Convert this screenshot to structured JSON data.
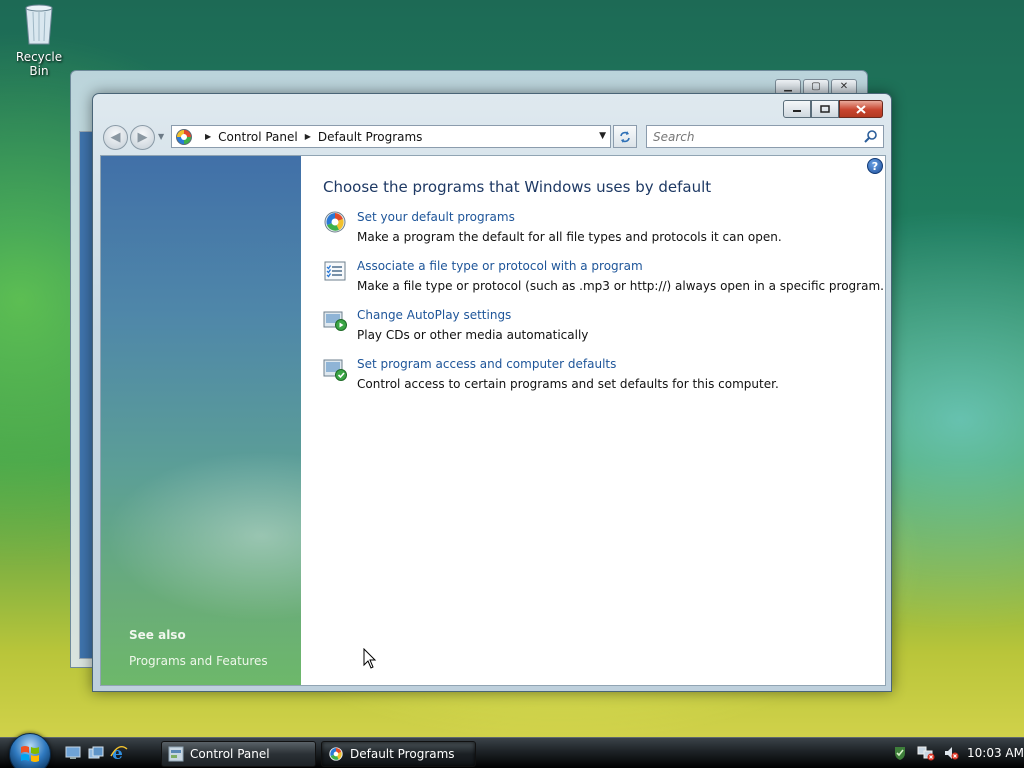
{
  "desktop": {
    "recycle_bin_label": "Recycle Bin"
  },
  "window": {
    "title": "Default Programs",
    "breadcrumb": [
      "Control Panel",
      "Default Programs"
    ],
    "search_placeholder": "Search",
    "heading": "Choose the programs that Windows uses by default",
    "tasks": [
      {
        "icon": "default-programs-icon",
        "link": "Set your default programs",
        "description": "Make a program the default for all file types and protocols it can open."
      },
      {
        "icon": "file-association-icon",
        "link": "Associate a file type or protocol with a program",
        "description": "Make a file type or protocol (such as .mp3 or http://) always open in a specific program."
      },
      {
        "icon": "autoplay-icon",
        "link": "Change AutoPlay settings",
        "description": "Play CDs or other media automatically"
      },
      {
        "icon": "program-access-icon",
        "link": "Set program access and computer defaults",
        "description": "Control access to certain programs and set defaults for this computer."
      }
    ],
    "see_also": {
      "title": "See also",
      "links": [
        "Programs and Features"
      ]
    }
  },
  "taskbar": {
    "buttons": [
      {
        "label": "Control Panel",
        "icon": "control-panel-icon",
        "active": false
      },
      {
        "label": "Default Programs",
        "icon": "default-programs-icon",
        "active": true
      }
    ],
    "clock": "10:03 AM"
  },
  "colors": {
    "link": "#1e5599",
    "heading": "#1e3964",
    "left_pane_top": "#4170a8",
    "left_pane_bottom": "#6db86a",
    "close_button": "#c8442e"
  }
}
